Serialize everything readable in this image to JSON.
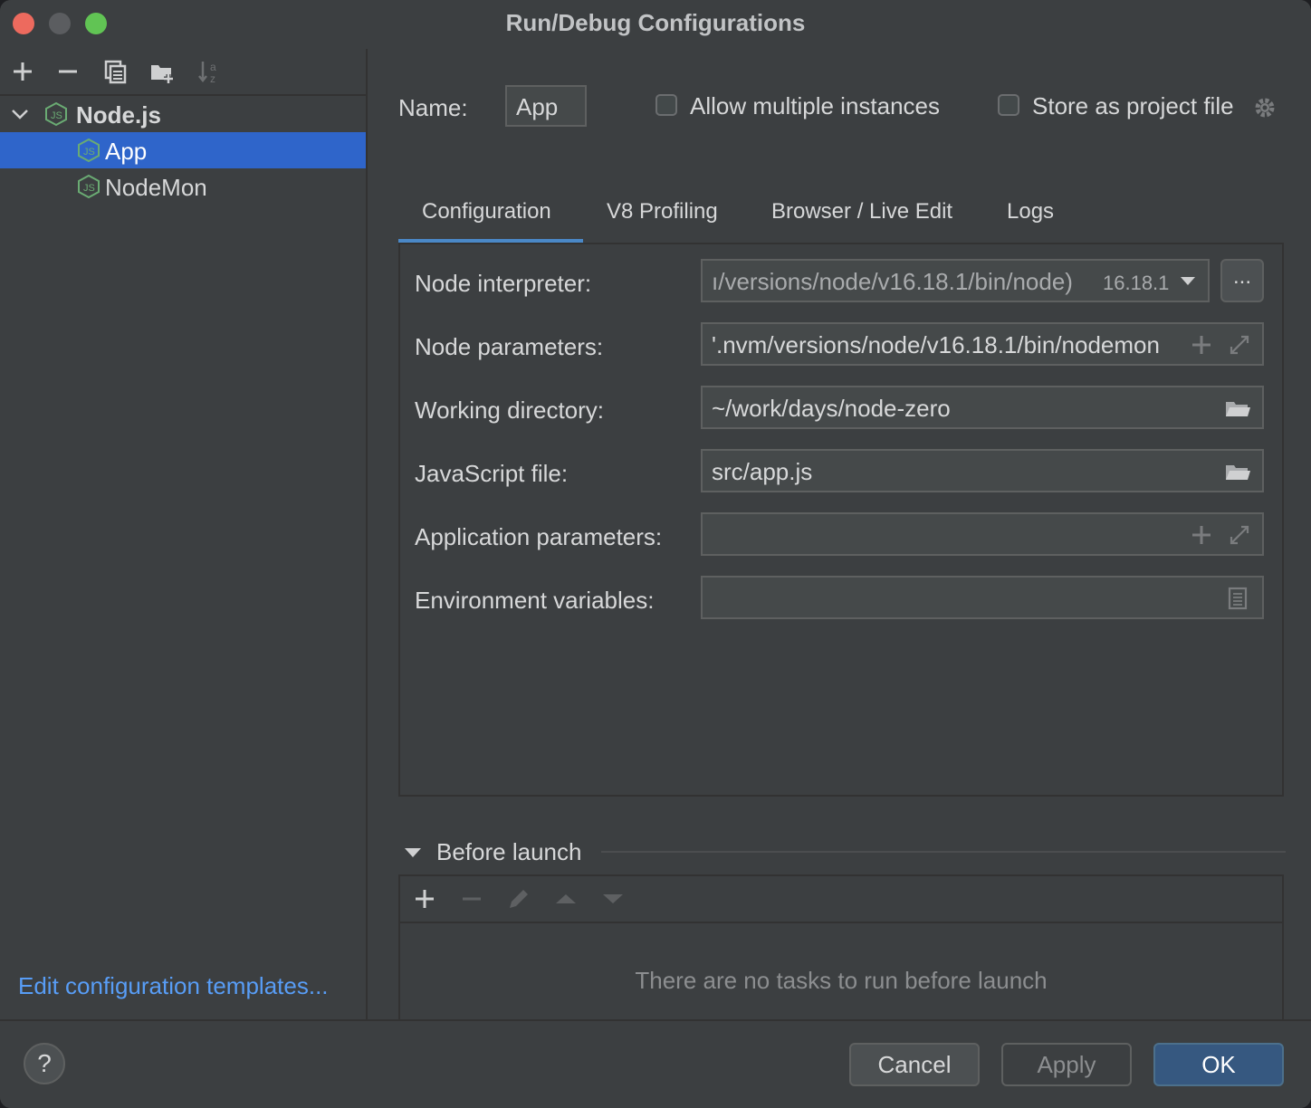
{
  "window": {
    "title": "Run/Debug Configurations"
  },
  "sidebar": {
    "toolbar_icons": [
      "add-icon",
      "remove-icon",
      "copy-icon",
      "new-folder-icon",
      "sort-icon"
    ],
    "tree": {
      "group": "Node.js",
      "items": [
        {
          "label": "App",
          "selected": true
        },
        {
          "label": "NodeMon",
          "selected": false
        }
      ]
    },
    "templates_link": "Edit configuration templates..."
  },
  "config": {
    "name_label": "Name:",
    "name_value": "App",
    "allow_multiple_label": "Allow multiple instances",
    "store_project_label": "Store as project file",
    "tabs": [
      "Configuration",
      "V8 Profiling",
      "Browser / Live Edit",
      "Logs"
    ],
    "active_tab": "Configuration",
    "fields": {
      "node_interpreter": {
        "label": "Node interpreter:",
        "value": "ı/versions/node/v16.18.1/bin/node)",
        "version": "16.18.1"
      },
      "node_parameters": {
        "label": "Node parameters:",
        "value": "'.nvm/versions/node/v16.18.1/bin/nodemon"
      },
      "working_directory": {
        "label": "Working directory:",
        "value": "~/work/days/node-zero"
      },
      "javascript_file": {
        "label": "JavaScript file:",
        "value": "src/app.js"
      },
      "application_parameters": {
        "label": "Application parameters:",
        "value": ""
      },
      "environment_variables": {
        "label": "Environment variables:",
        "value": ""
      }
    },
    "ellipsis_label": "..."
  },
  "before_launch": {
    "title": "Before launch",
    "empty_text": "There are no tasks to run before launch"
  },
  "footer": {
    "help_label": "?",
    "cancel_label": "Cancel",
    "apply_label": "Apply",
    "ok_label": "OK"
  },
  "colors": {
    "background": "#3c3f41",
    "selection": "#2f65ca",
    "link": "#589df6",
    "tab_underline": "#4a88c7",
    "ok_button": "#365880",
    "node_icon": "#6aab73"
  }
}
